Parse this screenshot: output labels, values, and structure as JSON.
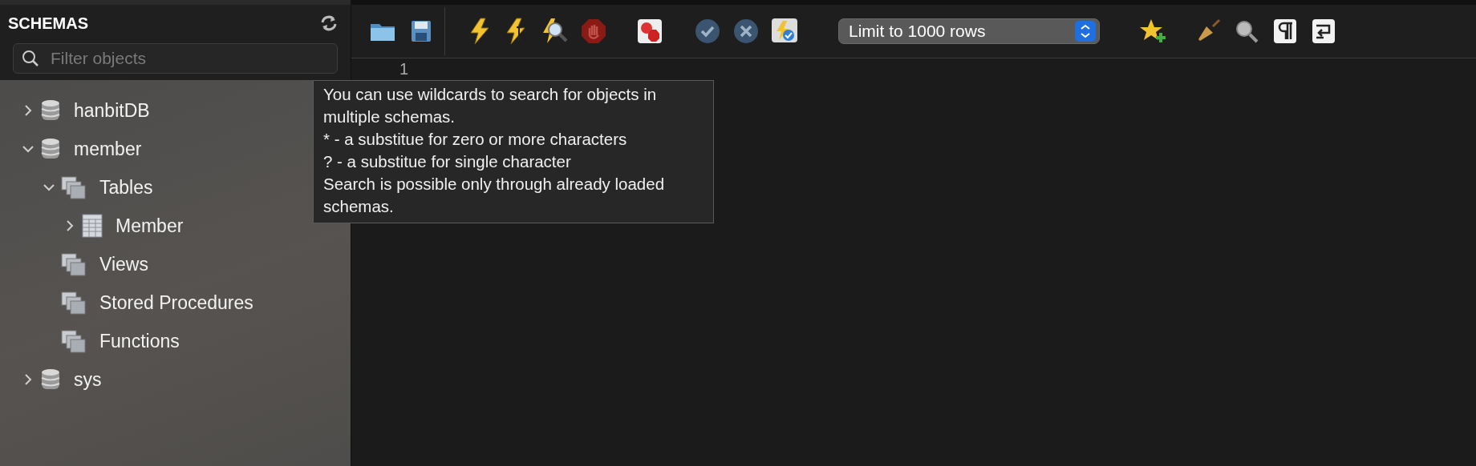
{
  "sidebar": {
    "title": "SCHEMAS",
    "filter": {
      "placeholder": "Filter objects"
    },
    "tree": [
      {
        "label": "hanbitDB",
        "kind": "schema",
        "expanded": false
      },
      {
        "label": "member",
        "kind": "schema",
        "expanded": true,
        "children": [
          {
            "label": "Tables",
            "kind": "group",
            "expanded": true,
            "children": [
              {
                "label": "Member",
                "kind": "table",
                "expanded": false
              }
            ]
          },
          {
            "label": "Views",
            "kind": "group"
          },
          {
            "label": "Stored Procedures",
            "kind": "group"
          },
          {
            "label": "Functions",
            "kind": "group"
          }
        ]
      },
      {
        "label": "sys",
        "kind": "schema",
        "expanded": false
      }
    ]
  },
  "toolbar": {
    "limit_select": "Limit to 1000 rows"
  },
  "editor": {
    "line_numbers": [
      "1"
    ]
  },
  "tooltip": {
    "paragraphs": [
      "You can use wildcards to search for objects in multiple schemas.",
      "* - a substitue for zero or more characters",
      "? - a substitue for single character",
      "Search is possible only through already loaded schemas."
    ]
  }
}
